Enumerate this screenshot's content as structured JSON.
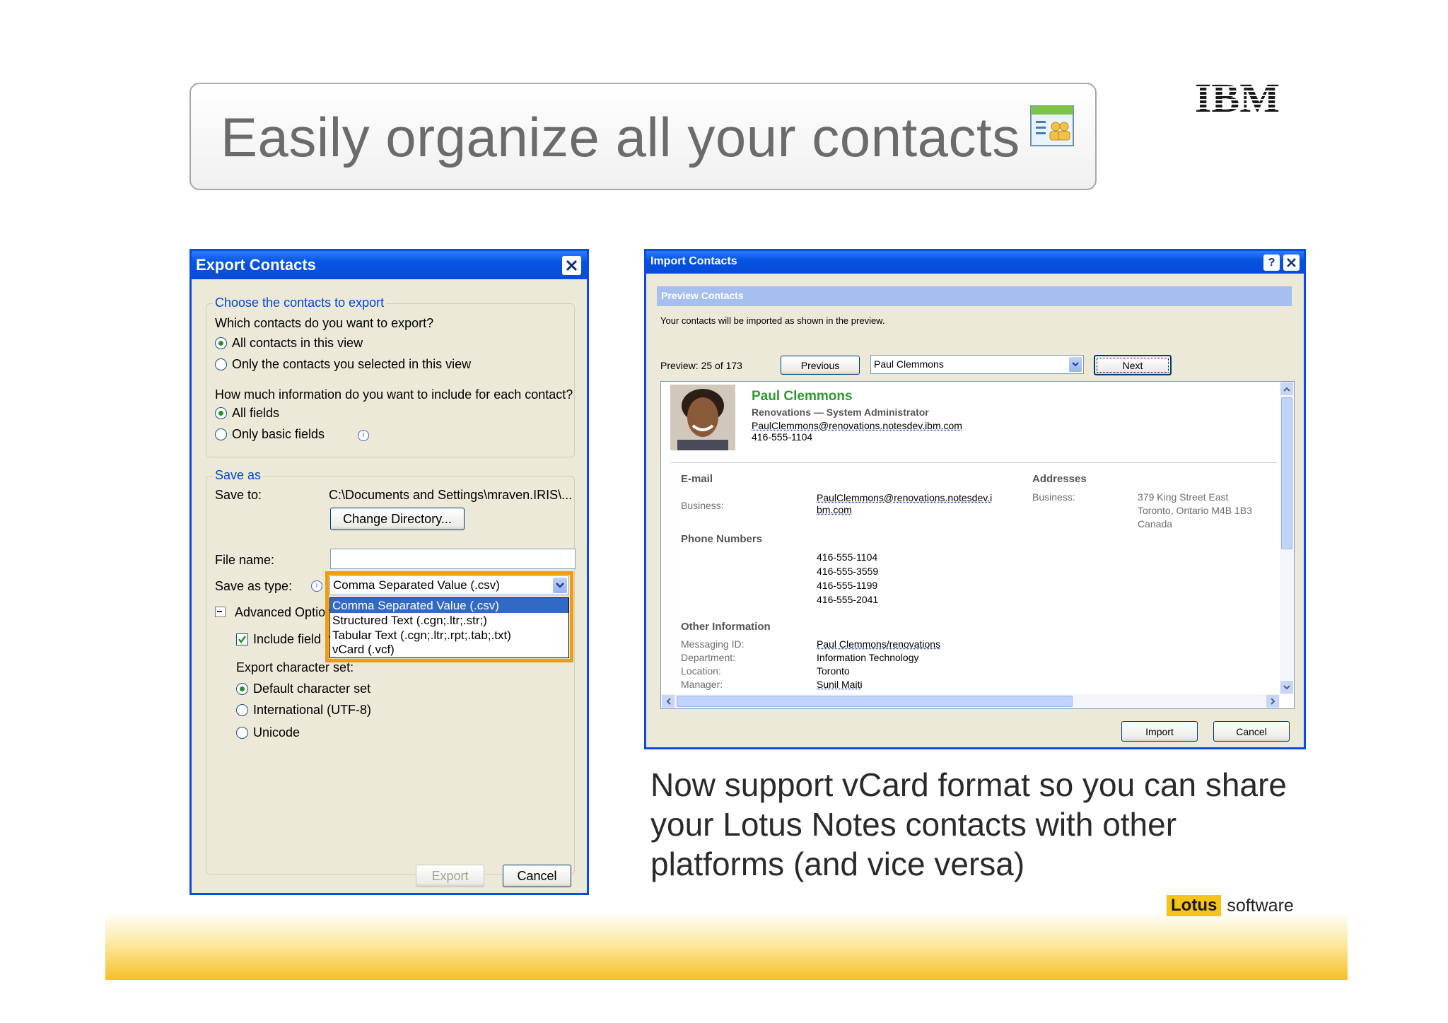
{
  "slide": {
    "title": "Easily organize all your contacts",
    "brand_logo": "IBM",
    "lotus_label": "Lotus",
    "software_label": "software",
    "caption": "Now support vCard format so you can share your Lotus Notes contacts with other platforms (and vice versa)",
    "title_icon": "contacts-icon"
  },
  "export_dialog": {
    "title": "Export Contacts",
    "choose_group": "Choose the contacts to export",
    "which_question": "Which contacts do you want to export?",
    "opt_all_contacts": "All contacts in this view",
    "opt_selected_contacts": "Only the contacts you selected in this view",
    "how_much_question": "How much information do you want to include for each contact?",
    "opt_all_fields": "All fields",
    "opt_basic_fields": "Only basic fields",
    "save_as_group": "Save as",
    "save_to_label": "Save to:",
    "save_to_path": "C:\\Documents and Settings\\mraven.IRIS\\...",
    "change_dir_button": "Change Directory...",
    "file_name_label": "File name:",
    "file_name_value": "",
    "save_type_label": "Save as type:",
    "save_type_value": "Comma Separated Value (.csv)",
    "type_options": [
      "Comma Separated Value (.csv)",
      "Structured Text (.cgn;.ltr;.str;)",
      "Tabular Text (.cgn;.ltr;.rpt;.tab;.txt)",
      "vCard (.vcf)"
    ],
    "advanced_label": "Advanced Optior",
    "include_field_label": "Include field n",
    "charset_label": "Export character set:",
    "opt_default_charset": "Default character set",
    "opt_international": "International (UTF-8)",
    "opt_unicode": "Unicode",
    "export_button": "Export",
    "cancel_button": "Cancel"
  },
  "import_dialog": {
    "title": "Import Contacts",
    "section_header": "Preview Contacts",
    "info_text": "Your contacts will be imported as shown in the preview.",
    "preview_count": "Preview: 25 of 173",
    "previous_button": "Previous",
    "contact_select": "Paul Clemmons",
    "next_button": "Next",
    "contact": {
      "name": "Paul Clemmons",
      "org_title": "Renovations — System Administrator",
      "email": "PaulClemmons@renovations.notesdev.ibm.com",
      "phone": "416-555-1104"
    },
    "email_section": "E-mail",
    "business_label": "Business:",
    "business_email_line1": "PaulClemmons@renovations.notesdev.i",
    "business_email_line2": "bm.com",
    "addresses_section": "Addresses",
    "address_business_label": "Business:",
    "address_lines": [
      "379 King Street East",
      "Toronto, Ontario  M4B 1B3",
      "Canada"
    ],
    "phone_section": "Phone Numbers",
    "phones": [
      "416-555-1104",
      "416-555-3559",
      "416-555-1199",
      "416-555-2041"
    ],
    "other_section": "Other Information",
    "other_info": [
      {
        "label": "Messaging ID:",
        "value": "Paul Clemmons/renovations"
      },
      {
        "label": "Department:",
        "value": "Information Technology"
      },
      {
        "label": "Location:",
        "value": "Toronto"
      },
      {
        "label": "Manager:",
        "value": "Sunil Maiti"
      }
    ],
    "import_button": "Import",
    "cancel_button": "Cancel"
  },
  "colors": {
    "xp_blue": "#0554e3",
    "highlight_orange": "#f29b0c",
    "contact_name_green": "#2e9a2e",
    "lotus_yellow": "#f5c417"
  }
}
